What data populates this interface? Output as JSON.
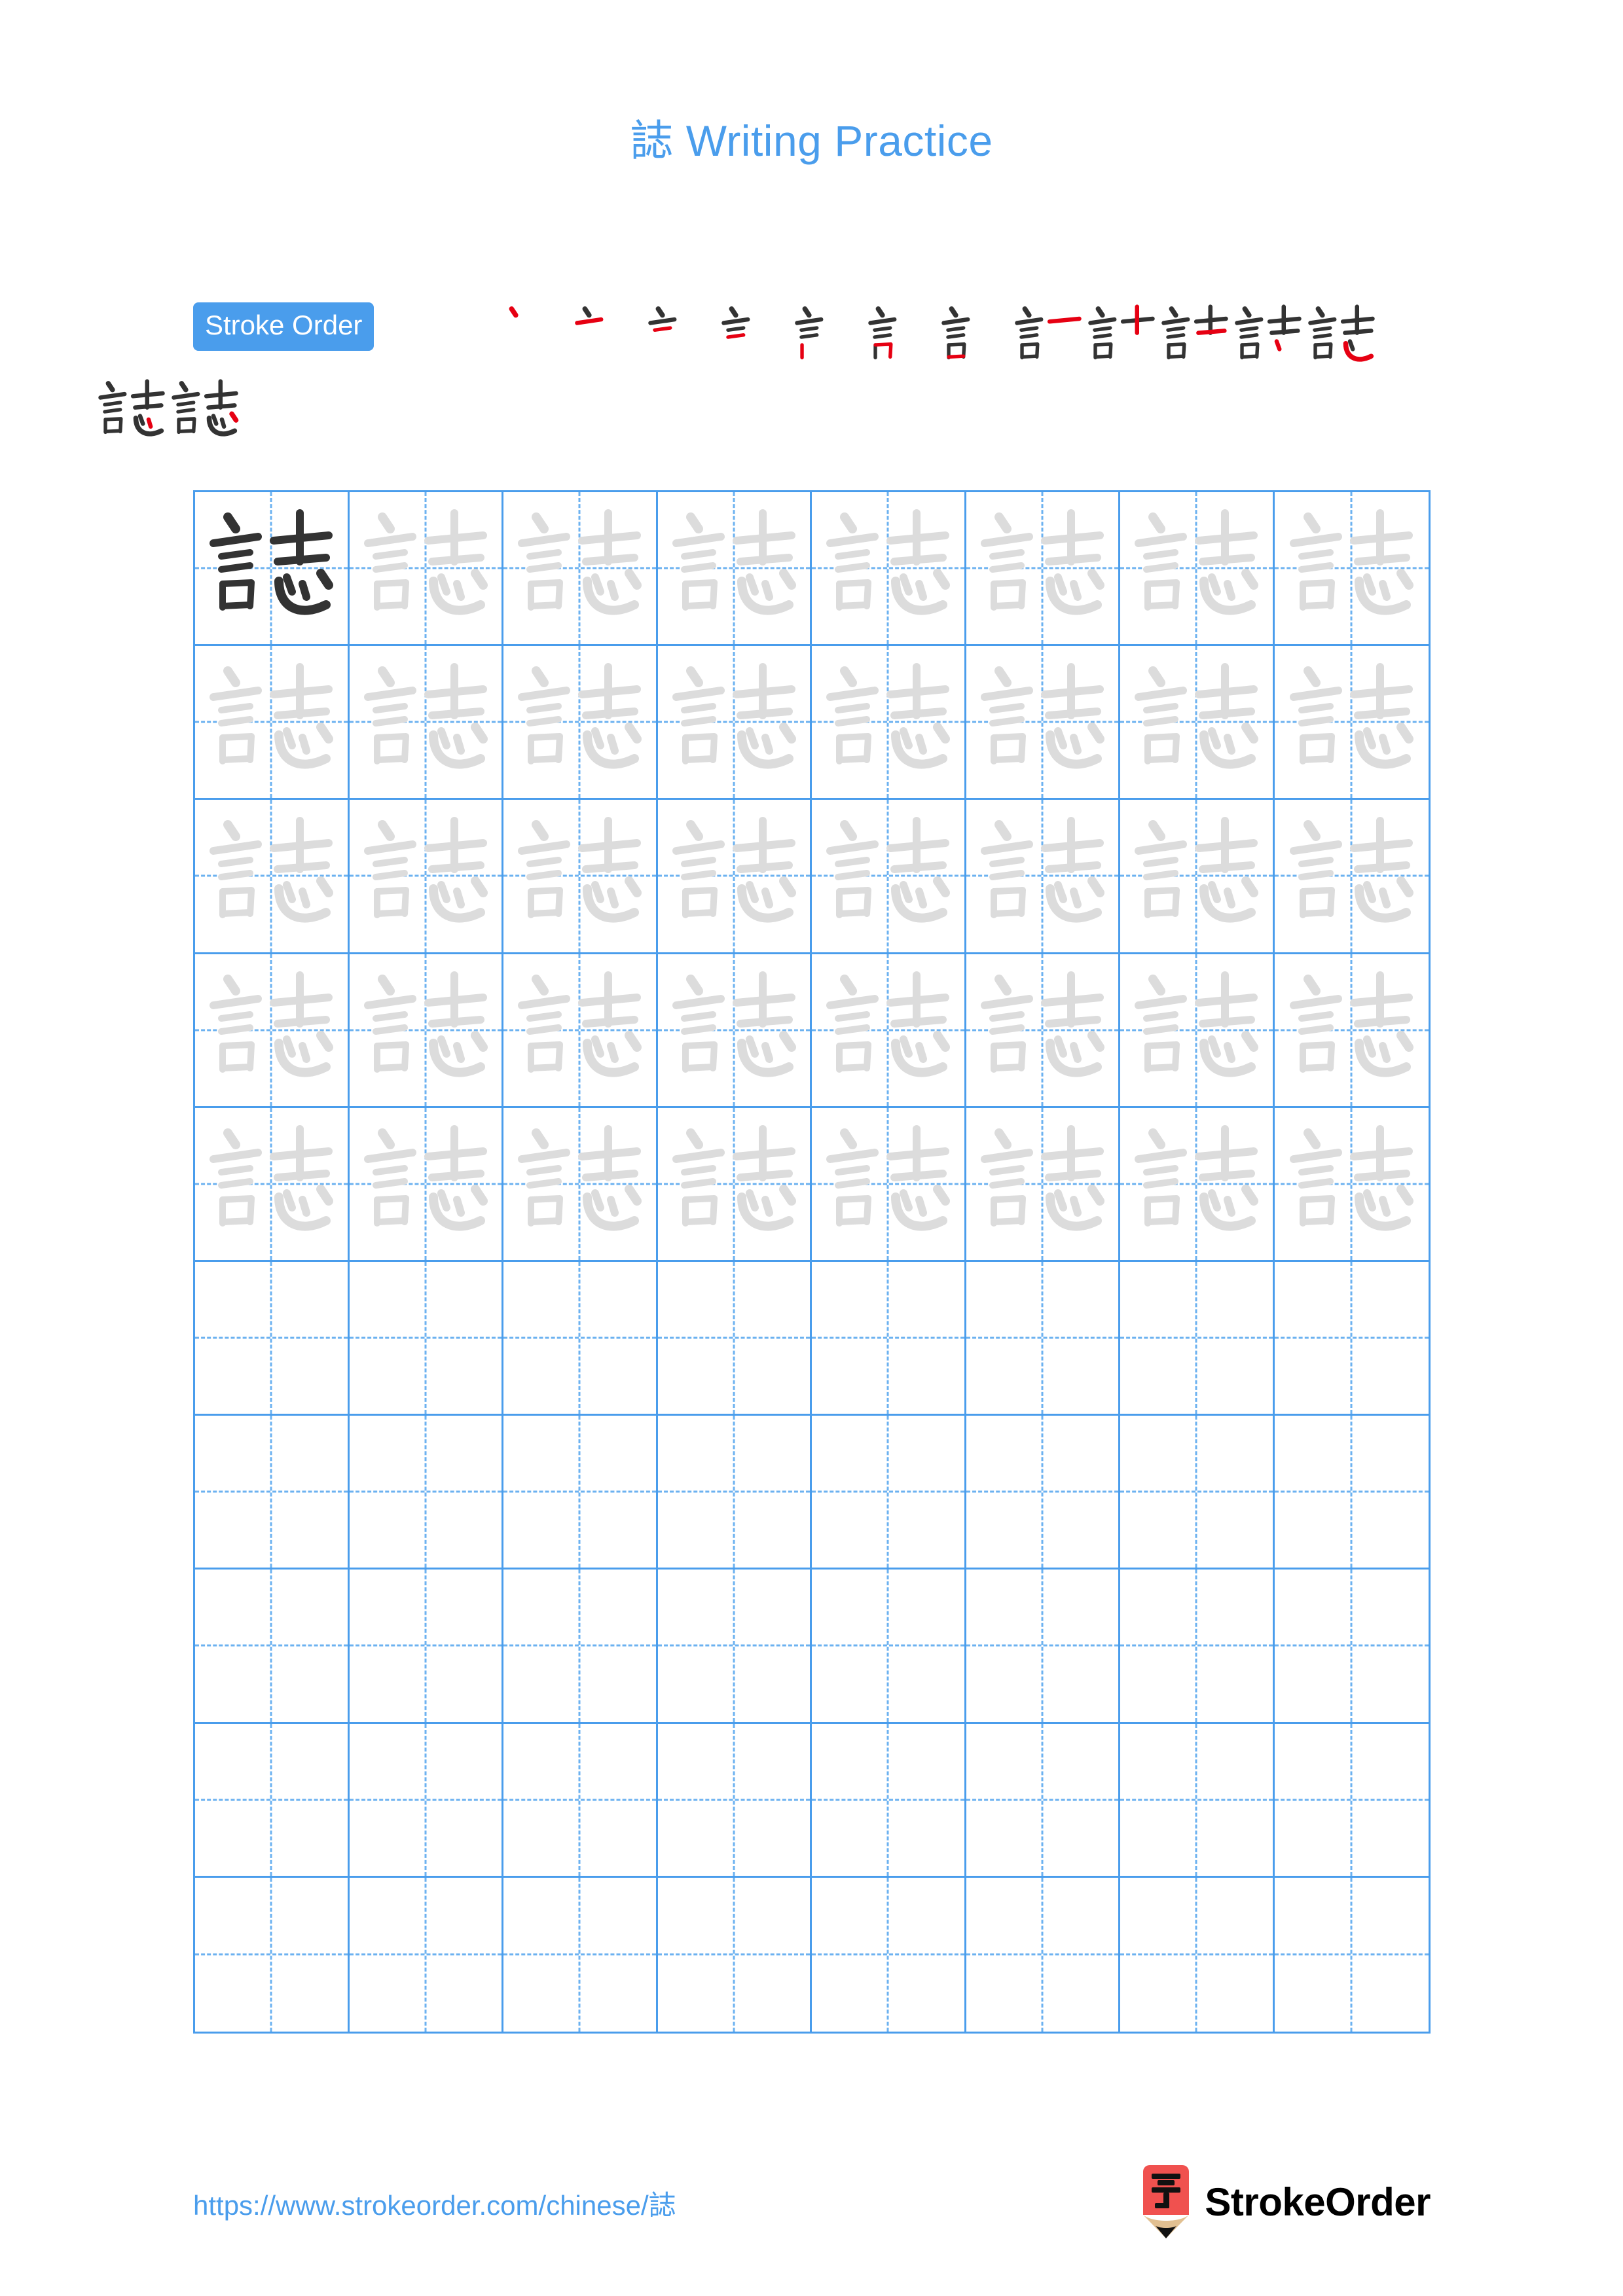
{
  "character": "誌",
  "title": {
    "character": "誌",
    "rest": " Writing Practice",
    "full": "誌 Writing Practice",
    "color": "#4a9dec"
  },
  "stroke_order": {
    "badge_label": "Stroke Order",
    "badge_bg": "#4a9dec",
    "badge_text_color": "#ffffff",
    "total_strokes": 14,
    "completed_stroke_color": "#333333",
    "current_stroke_color": "#e60012",
    "steps": [
      {
        "index": 1,
        "strokes_drawn": 1,
        "new_stroke": "dot (丶) top-left of 言 radical"
      },
      {
        "index": 2,
        "strokes_drawn": 2,
        "new_stroke": "horizontal (一) below the dot"
      },
      {
        "index": 3,
        "strokes_drawn": 3,
        "new_stroke": "short horizontal (一) second bar"
      },
      {
        "index": 4,
        "strokes_drawn": 4,
        "new_stroke": "short horizontal (一) third bar"
      },
      {
        "index": 5,
        "strokes_drawn": 5,
        "new_stroke": "vertical (丨) of 口 in 言"
      },
      {
        "index": 6,
        "strokes_drawn": 6,
        "new_stroke": "horizontal-fold (𠃍) of 口"
      },
      {
        "index": 7,
        "strokes_drawn": 7,
        "new_stroke": "bottom horizontal (一) closing 口"
      },
      {
        "index": 8,
        "strokes_drawn": 8,
        "new_stroke": "horizontal (一) top of 志"
      },
      {
        "index": 9,
        "strokes_drawn": 9,
        "new_stroke": "vertical (丨) of 士"
      },
      {
        "index": 10,
        "strokes_drawn": 10,
        "new_stroke": "horizontal (一) lower bar of 士"
      },
      {
        "index": 11,
        "strokes_drawn": 11,
        "new_stroke": "left dot of 心"
      },
      {
        "index": 12,
        "strokes_drawn": 12,
        "new_stroke": "slanted hook (㇃) of 心"
      },
      {
        "index": 13,
        "strokes_drawn": 13,
        "new_stroke": "middle dot of 心"
      },
      {
        "index": 14,
        "strokes_drawn": 14,
        "new_stroke": "right dot of 心 (final stroke)"
      }
    ],
    "row_split": [
      12,
      2
    ]
  },
  "practice_grid": {
    "rows": 10,
    "columns": 8,
    "border_color": "#4a9dec",
    "guide_color": "#6cb2f0",
    "model_char_color": "#333333",
    "trace_char_color": "#dcdcdc",
    "filled_rows": 5,
    "empty_rows": 5,
    "cells": [
      [
        "dark",
        "light",
        "light",
        "light",
        "light",
        "light",
        "light",
        "light"
      ],
      [
        "light",
        "light",
        "light",
        "light",
        "light",
        "light",
        "light",
        "light"
      ],
      [
        "light",
        "light",
        "light",
        "light",
        "light",
        "light",
        "light",
        "light"
      ],
      [
        "light",
        "light",
        "light",
        "light",
        "light",
        "light",
        "light",
        "light"
      ],
      [
        "light",
        "light",
        "light",
        "light",
        "light",
        "light",
        "light",
        "light"
      ],
      [
        "empty",
        "empty",
        "empty",
        "empty",
        "empty",
        "empty",
        "empty",
        "empty"
      ],
      [
        "empty",
        "empty",
        "empty",
        "empty",
        "empty",
        "empty",
        "empty",
        "empty"
      ],
      [
        "empty",
        "empty",
        "empty",
        "empty",
        "empty",
        "empty",
        "empty",
        "empty"
      ],
      [
        "empty",
        "empty",
        "empty",
        "empty",
        "empty",
        "empty",
        "empty",
        "empty"
      ],
      [
        "empty",
        "empty",
        "empty",
        "empty",
        "empty",
        "empty",
        "empty",
        "empty"
      ]
    ]
  },
  "footer": {
    "url": "https://www.strokeorder.com/chinese/誌",
    "url_color": "#4a9dec",
    "brand_name": "StrokeOrder",
    "logo": {
      "icon_name": "pencil-logo-icon",
      "body_color": "#f0514f",
      "glyph": "字",
      "glyph_color": "#111111",
      "wood_color": "#e2c091",
      "tip_color": "#111111"
    }
  }
}
